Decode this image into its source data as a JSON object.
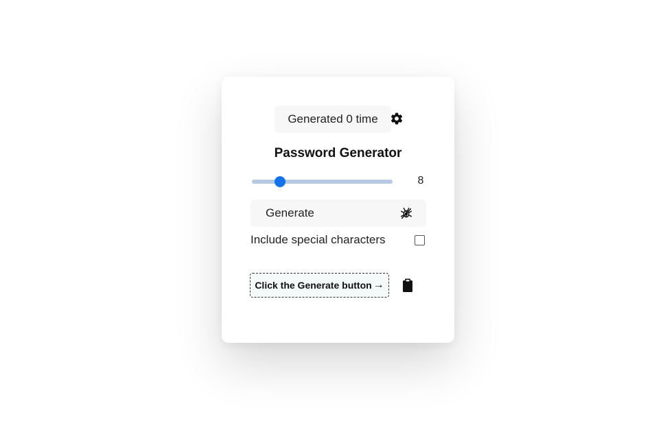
{
  "app": {
    "counter_text": "Generated 0 time",
    "title": "Password Generator"
  },
  "length_slider": {
    "min": 4,
    "max": 24,
    "value": 8,
    "value_text": "8",
    "accent_color": "#1273ea",
    "track_color": "#b6c8e2"
  },
  "generate": {
    "label": "Generate",
    "icon": "bug-icon"
  },
  "options": {
    "special_characters_label": "Include special characters",
    "special_characters_checked": false
  },
  "output": {
    "placeholder_text": "Click the Generate button",
    "arrow": "→"
  },
  "icons": {
    "settings": "gear-icon",
    "copy": "clipboard-icon"
  }
}
